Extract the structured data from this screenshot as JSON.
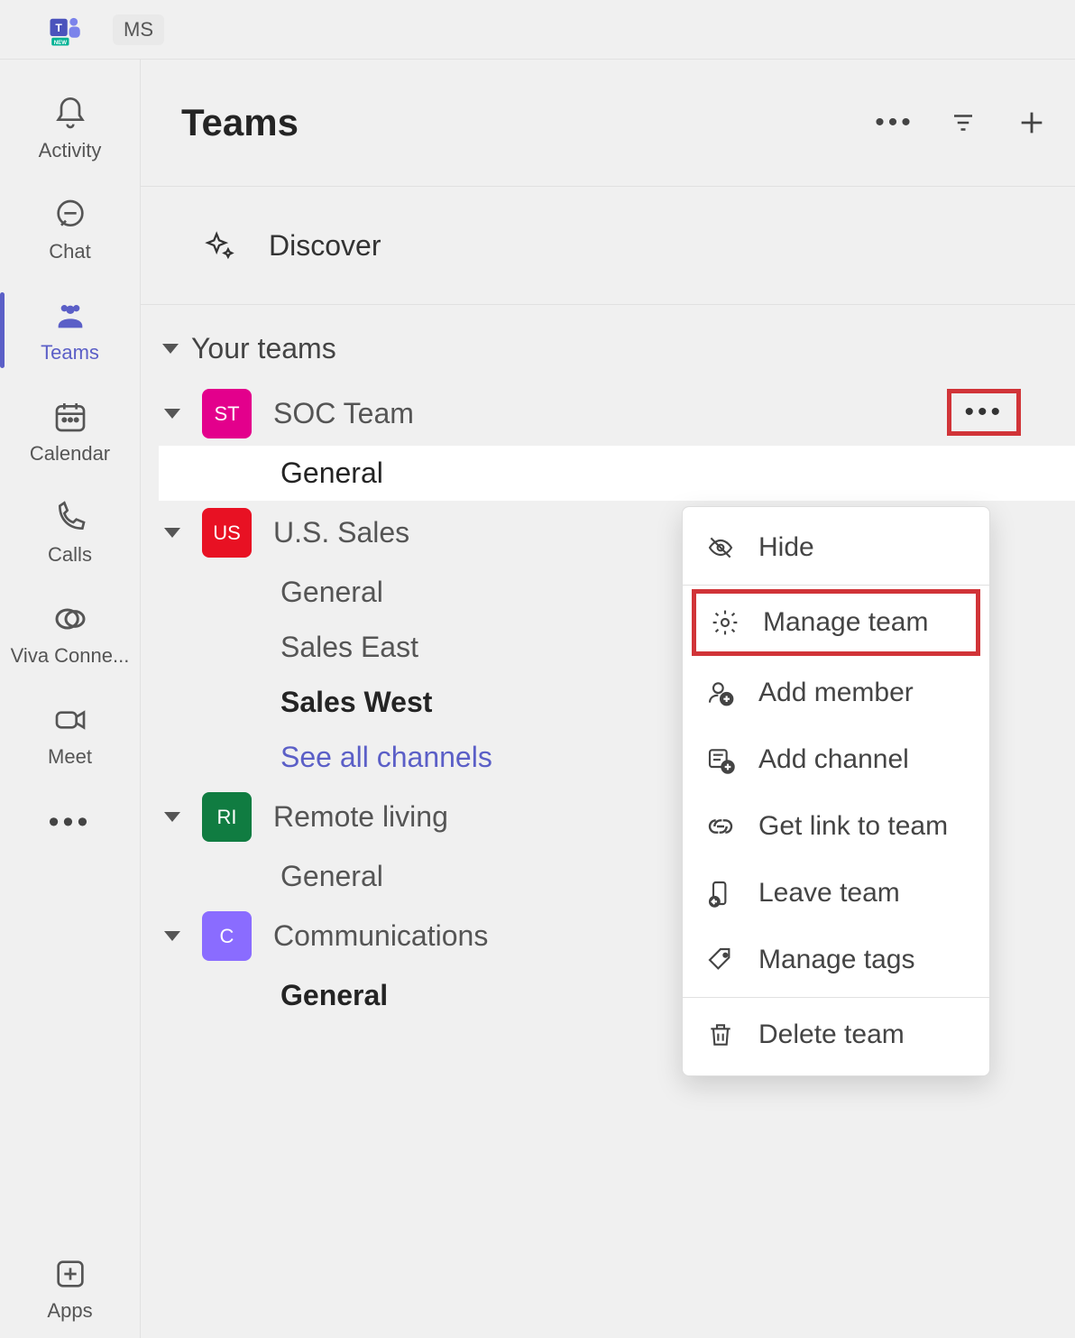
{
  "topbar": {
    "ms_label": "MS"
  },
  "rail": {
    "items": [
      {
        "key": "activity",
        "label": "Activity"
      },
      {
        "key": "chat",
        "label": "Chat"
      },
      {
        "key": "teams",
        "label": "Teams"
      },
      {
        "key": "calendar",
        "label": "Calendar"
      },
      {
        "key": "calls",
        "label": "Calls"
      },
      {
        "key": "viva",
        "label": "Viva Conne..."
      },
      {
        "key": "meet",
        "label": "Meet"
      }
    ],
    "apps_label": "Apps"
  },
  "panel": {
    "title": "Teams",
    "discover_label": "Discover",
    "section_label": "Your teams",
    "teams": [
      {
        "initials": "ST",
        "name": "SOC Team",
        "avatar": "av-st",
        "channels": [
          {
            "name": "General",
            "selected": true
          }
        ],
        "has_more_highlight": true
      },
      {
        "initials": "US",
        "name": "U.S. Sales",
        "avatar": "av-us",
        "channels": [
          {
            "name": "General"
          },
          {
            "name": "Sales East"
          },
          {
            "name": "Sales West",
            "bold": true
          }
        ],
        "see_all": "See all channels"
      },
      {
        "initials": "RI",
        "name": "Remote living",
        "avatar": "av-rl",
        "channels": [
          {
            "name": "General"
          }
        ]
      },
      {
        "initials": "C",
        "name": "Communications",
        "avatar": "av-c",
        "channels": [
          {
            "name": "General",
            "bold": true
          }
        ]
      }
    ]
  },
  "context_menu": {
    "items": [
      {
        "key": "hide",
        "label": "Hide",
        "icon": "eye-off"
      },
      {
        "sep": true
      },
      {
        "key": "manage",
        "label": "Manage team",
        "icon": "gear",
        "highlight": true
      },
      {
        "key": "add-member",
        "label": "Add member",
        "icon": "person-add"
      },
      {
        "key": "add-channel",
        "label": "Add channel",
        "icon": "channel-add"
      },
      {
        "key": "get-link",
        "label": "Get link to team",
        "icon": "link"
      },
      {
        "key": "leave",
        "label": "Leave team",
        "icon": "leave"
      },
      {
        "key": "tags",
        "label": "Manage tags",
        "icon": "tag"
      },
      {
        "sep": true
      },
      {
        "key": "delete",
        "label": "Delete team",
        "icon": "trash"
      }
    ]
  }
}
